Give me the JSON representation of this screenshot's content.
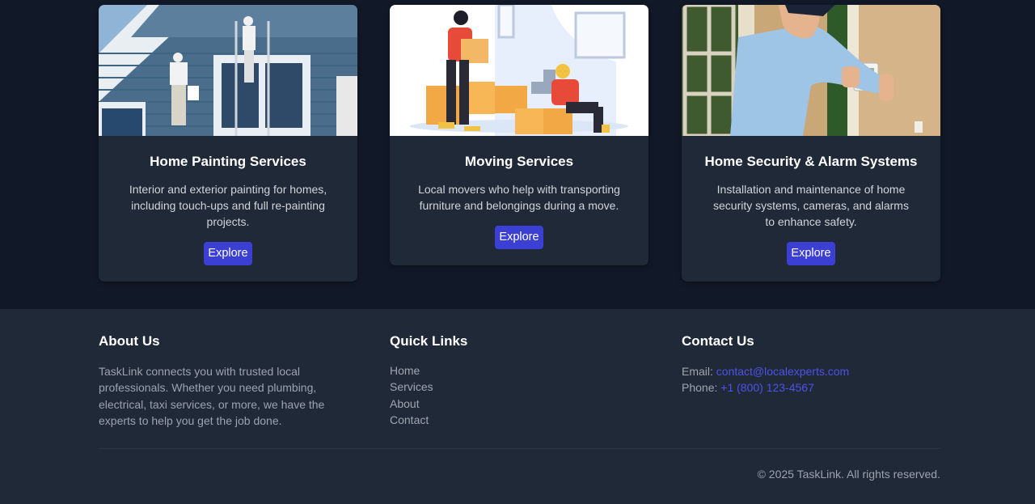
{
  "services": [
    {
      "title": "Home Painting Services",
      "description": "Interior and exterior painting for homes, including touch-ups and full re-painting projects.",
      "button_label": "Explore",
      "image": "painters-on-house-photo"
    },
    {
      "title": "Moving Services",
      "description": "Local movers who help with transporting furniture and belongings during a move.",
      "button_label": "Explore",
      "image": "movers-with-boxes-illustration"
    },
    {
      "title": "Home Security & Alarm Systems",
      "description": "Installation and maintenance of home security systems, cameras, and alarms to enhance safety.",
      "button_label": "Explore",
      "image": "technician-alarm-panel-photo"
    }
  ],
  "footer": {
    "about": {
      "heading": "About Us",
      "text": "TaskLink connects you with trusted local professionals. Whether you need plumbing, electrical, taxi services, or more, we have the experts to help you get the job done."
    },
    "quick_links": {
      "heading": "Quick Links",
      "items": [
        "Home",
        "Services",
        "About",
        "Contact"
      ]
    },
    "contact": {
      "heading": "Contact Us",
      "email_label": "Email:",
      "email": "contact@localexperts.com",
      "phone_label": "Phone:",
      "phone": "+1 (800) 123-4567"
    },
    "copyright": "© 2025 TaskLink. All rights reserved."
  },
  "colors": {
    "page_bg": "#111827",
    "card_bg": "#1f2937",
    "button": "#3b3fd4",
    "link": "#4f52e8"
  }
}
